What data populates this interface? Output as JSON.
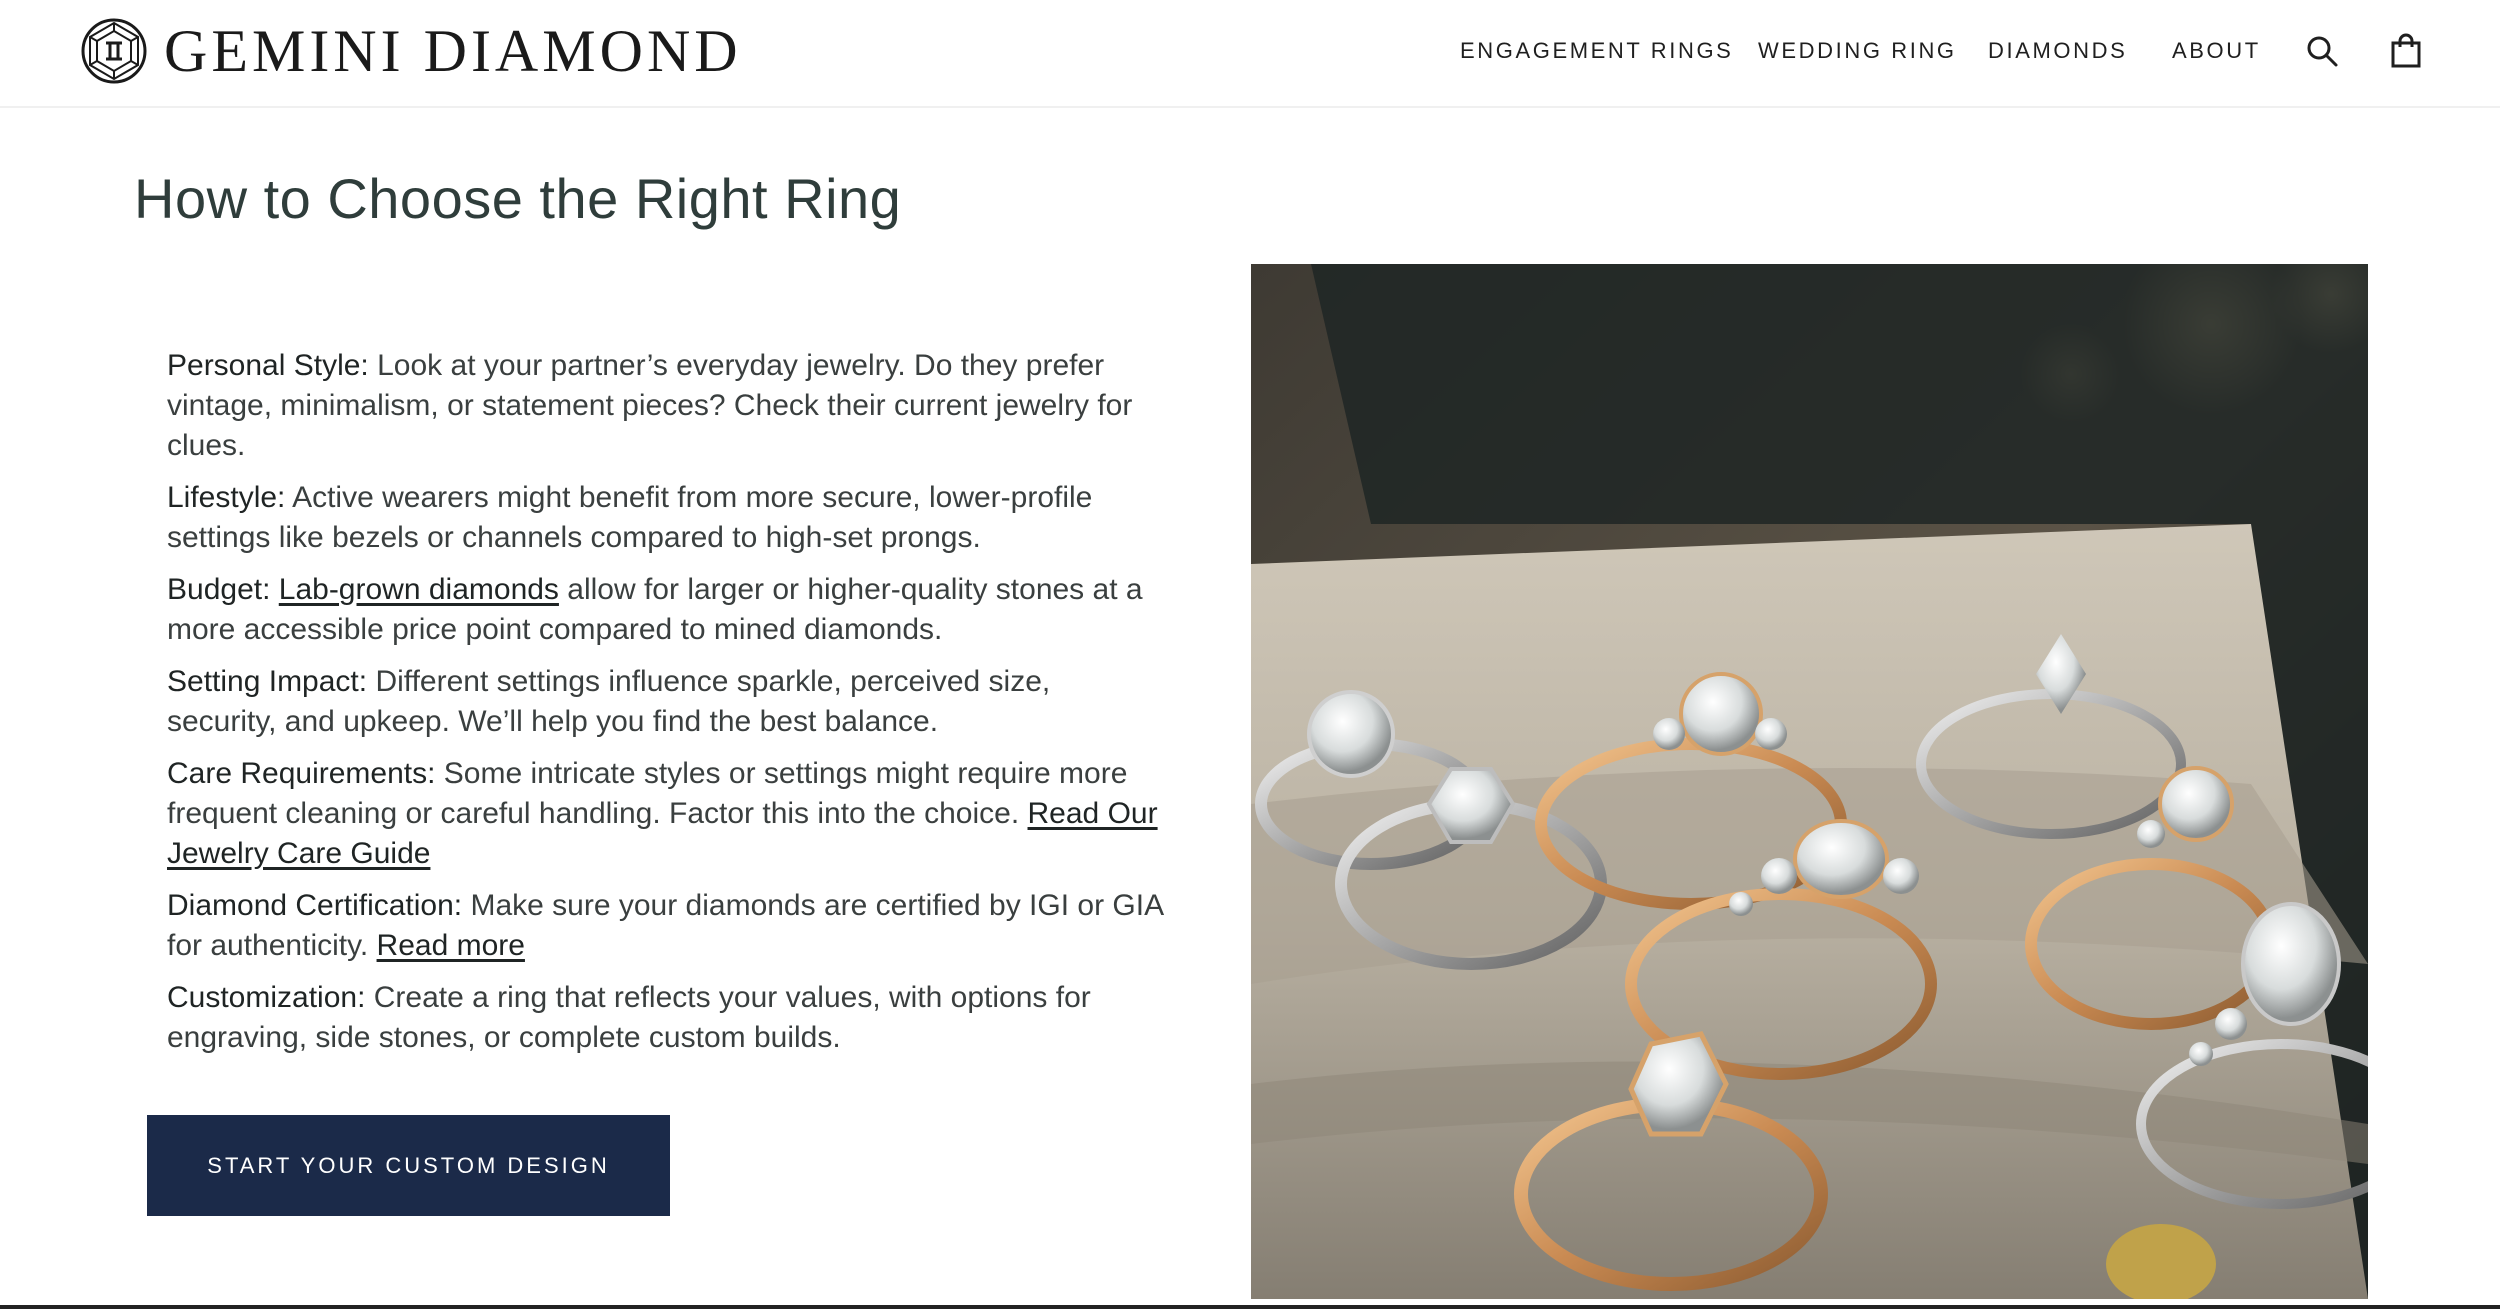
{
  "brand": {
    "name": "GEMINI DIAMOND",
    "logo_icon": "gemini-diamond-logo-icon"
  },
  "nav": {
    "items": [
      {
        "label": "ENGAGEMENT RINGS"
      },
      {
        "label": "WEDDING RING"
      },
      {
        "label": "DIAMONDS"
      },
      {
        "label": "ABOUT"
      }
    ],
    "search_icon": "search-icon",
    "cart_icon": "shopping-bag-icon"
  },
  "page": {
    "title": "How to Choose the Right Ring"
  },
  "guide": {
    "personal_style": {
      "label": "Personal Style:",
      "text": " Look at your partner’s everyday jewelry. Do they prefer vintage, minimalism, or statement pieces? Check their current jewelry for clues."
    },
    "lifestyle": {
      "label": "Lifestyle:",
      "text": " Active wearers might benefit from more secure, lower-profile settings like bezels or channels compared to high-set prongs."
    },
    "budget": {
      "label": "Budget:",
      "link": "Lab-grown diamonds",
      "text": " allow for larger or higher-quality stones at a more accessible price point compared to mined diamonds."
    },
    "setting_impact": {
      "label": "Setting Impact:",
      "text": " Different settings influence sparkle, perceived size, security, and upkeep. We’ll help you find the best balance."
    },
    "care": {
      "label": "Care Requirements:",
      "text": " Some intricate styles or settings might require more frequent cleaning or careful handling. Factor this into the choice. ",
      "link": "Read Our Jewelry Care Guide"
    },
    "certification": {
      "label": "Diamond Certification:",
      "text": " Make sure your diamonds are certified by IGI or GIA for authenticity. ",
      "link": "Read more"
    },
    "customization": {
      "label": "Customization:",
      "text": " Create a ring that reflects your values, with options for engraving, side stones, or complete custom builds."
    }
  },
  "cta": {
    "label": "START YOUR CUSTOM DESIGN"
  },
  "colors": {
    "cta_bg": "#1b2a49",
    "title": "#2f3d3b",
    "text": "#3a3f3f"
  }
}
